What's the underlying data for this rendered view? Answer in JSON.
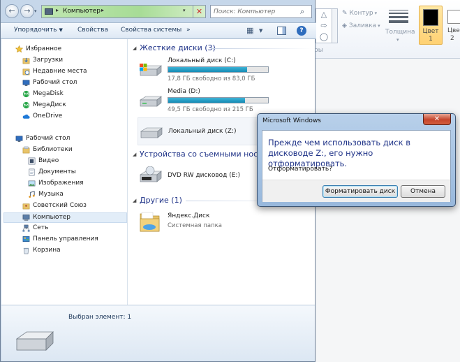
{
  "paint": {
    "outline_label": "Контур",
    "fill_label": "Заливка",
    "group_label": "ры",
    "thickness_label": "Толщина",
    "color1_label": "Цвет\n1",
    "color1_line1": "Цвет",
    "color1_line2": "1",
    "color2_line1": "Цвет",
    "color2_line2": "2"
  },
  "explorer": {
    "address": {
      "path_item": "Компьютер"
    },
    "search": {
      "placeholder": "Поиск: Компьютер"
    },
    "toolbar": {
      "organize": "Упорядочить",
      "properties": "Свойства",
      "system_properties": "Свойства системы",
      "more": "»"
    },
    "nav": {
      "favorites": "Избранное",
      "downloads": "Загрузки",
      "recent": "Недавние места",
      "desktop_fav": "Рабочий стол",
      "megadisk1": "MegaDisk",
      "megadisk2": "MegaДиск",
      "onedrive": "OneDrive",
      "desktop": "Рабочий стол",
      "libraries": "Библиотеки",
      "video": "Видео",
      "documents": "Документы",
      "images": "Изображения",
      "music": "Музыка",
      "soviet": "Советский Союз",
      "computer": "Компьютер",
      "network": "Сеть",
      "control_panel": "Панель управления",
      "recycle": "Корзина"
    },
    "groups": {
      "hdd": "Жесткие диски (3)",
      "removable": "Устройства со съемными носит",
      "other": "Другие (1)"
    },
    "drives": {
      "c_name": "Локальный диск (C:)",
      "c_free": "17,8 ГБ свободно из 83,0 ГБ",
      "c_used": 0.79,
      "d_name": "Media (D:)",
      "d_free": "49,5 ГБ свободно из 215 ГБ",
      "d_used": 0.77,
      "z_name": "Локальный диск (Z:)",
      "dvd_name": "DVD RW дисковод (E:)",
      "dvd_badge": "DVD",
      "yandex_name": "Яндекс.Диск",
      "yandex_sub": "Системная папка"
    },
    "details": {
      "selected": "Выбран элемент: 1"
    }
  },
  "dialog": {
    "title": "Microsoft Windows",
    "close": "✕",
    "message": "Прежде чем использовать диск в дисководе Z:, его нужно отформатировать.",
    "question": "Отформатировать?",
    "format_button": "Форматировать диск",
    "cancel_button": "Отмена"
  },
  "colors": {
    "accent_blue": "#1e3287",
    "drive_bar": "#1e9fc8",
    "dialog_close": "#c5452c"
  }
}
